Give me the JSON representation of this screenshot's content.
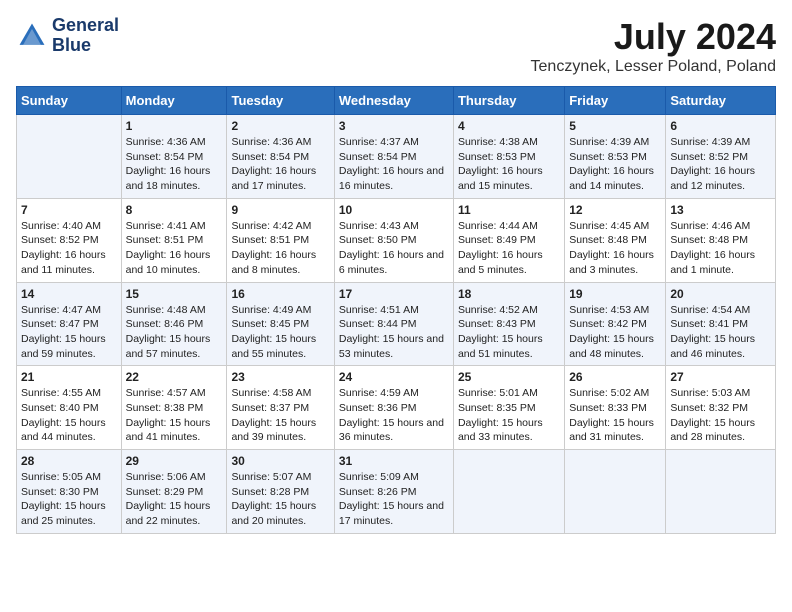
{
  "logo": {
    "line1": "General",
    "line2": "Blue"
  },
  "title": "July 2024",
  "subtitle": "Tenczynek, Lesser Poland, Poland",
  "days_header": [
    "Sunday",
    "Monday",
    "Tuesday",
    "Wednesday",
    "Thursday",
    "Friday",
    "Saturday"
  ],
  "weeks": [
    [
      {
        "day": "",
        "sunrise": "",
        "sunset": "",
        "daylight": ""
      },
      {
        "day": "1",
        "sunrise": "Sunrise: 4:36 AM",
        "sunset": "Sunset: 8:54 PM",
        "daylight": "Daylight: 16 hours and 18 minutes."
      },
      {
        "day": "2",
        "sunrise": "Sunrise: 4:36 AM",
        "sunset": "Sunset: 8:54 PM",
        "daylight": "Daylight: 16 hours and 17 minutes."
      },
      {
        "day": "3",
        "sunrise": "Sunrise: 4:37 AM",
        "sunset": "Sunset: 8:54 PM",
        "daylight": "Daylight: 16 hours and 16 minutes."
      },
      {
        "day": "4",
        "sunrise": "Sunrise: 4:38 AM",
        "sunset": "Sunset: 8:53 PM",
        "daylight": "Daylight: 16 hours and 15 minutes."
      },
      {
        "day": "5",
        "sunrise": "Sunrise: 4:39 AM",
        "sunset": "Sunset: 8:53 PM",
        "daylight": "Daylight: 16 hours and 14 minutes."
      },
      {
        "day": "6",
        "sunrise": "Sunrise: 4:39 AM",
        "sunset": "Sunset: 8:52 PM",
        "daylight": "Daylight: 16 hours and 12 minutes."
      }
    ],
    [
      {
        "day": "7",
        "sunrise": "Sunrise: 4:40 AM",
        "sunset": "Sunset: 8:52 PM",
        "daylight": "Daylight: 16 hours and 11 minutes."
      },
      {
        "day": "8",
        "sunrise": "Sunrise: 4:41 AM",
        "sunset": "Sunset: 8:51 PM",
        "daylight": "Daylight: 16 hours and 10 minutes."
      },
      {
        "day": "9",
        "sunrise": "Sunrise: 4:42 AM",
        "sunset": "Sunset: 8:51 PM",
        "daylight": "Daylight: 16 hours and 8 minutes."
      },
      {
        "day": "10",
        "sunrise": "Sunrise: 4:43 AM",
        "sunset": "Sunset: 8:50 PM",
        "daylight": "Daylight: 16 hours and 6 minutes."
      },
      {
        "day": "11",
        "sunrise": "Sunrise: 4:44 AM",
        "sunset": "Sunset: 8:49 PM",
        "daylight": "Daylight: 16 hours and 5 minutes."
      },
      {
        "day": "12",
        "sunrise": "Sunrise: 4:45 AM",
        "sunset": "Sunset: 8:48 PM",
        "daylight": "Daylight: 16 hours and 3 minutes."
      },
      {
        "day": "13",
        "sunrise": "Sunrise: 4:46 AM",
        "sunset": "Sunset: 8:48 PM",
        "daylight": "Daylight: 16 hours and 1 minute."
      }
    ],
    [
      {
        "day": "14",
        "sunrise": "Sunrise: 4:47 AM",
        "sunset": "Sunset: 8:47 PM",
        "daylight": "Daylight: 15 hours and 59 minutes."
      },
      {
        "day": "15",
        "sunrise": "Sunrise: 4:48 AM",
        "sunset": "Sunset: 8:46 PM",
        "daylight": "Daylight: 15 hours and 57 minutes."
      },
      {
        "day": "16",
        "sunrise": "Sunrise: 4:49 AM",
        "sunset": "Sunset: 8:45 PM",
        "daylight": "Daylight: 15 hours and 55 minutes."
      },
      {
        "day": "17",
        "sunrise": "Sunrise: 4:51 AM",
        "sunset": "Sunset: 8:44 PM",
        "daylight": "Daylight: 15 hours and 53 minutes."
      },
      {
        "day": "18",
        "sunrise": "Sunrise: 4:52 AM",
        "sunset": "Sunset: 8:43 PM",
        "daylight": "Daylight: 15 hours and 51 minutes."
      },
      {
        "day": "19",
        "sunrise": "Sunrise: 4:53 AM",
        "sunset": "Sunset: 8:42 PM",
        "daylight": "Daylight: 15 hours and 48 minutes."
      },
      {
        "day": "20",
        "sunrise": "Sunrise: 4:54 AM",
        "sunset": "Sunset: 8:41 PM",
        "daylight": "Daylight: 15 hours and 46 minutes."
      }
    ],
    [
      {
        "day": "21",
        "sunrise": "Sunrise: 4:55 AM",
        "sunset": "Sunset: 8:40 PM",
        "daylight": "Daylight: 15 hours and 44 minutes."
      },
      {
        "day": "22",
        "sunrise": "Sunrise: 4:57 AM",
        "sunset": "Sunset: 8:38 PM",
        "daylight": "Daylight: 15 hours and 41 minutes."
      },
      {
        "day": "23",
        "sunrise": "Sunrise: 4:58 AM",
        "sunset": "Sunset: 8:37 PM",
        "daylight": "Daylight: 15 hours and 39 minutes."
      },
      {
        "day": "24",
        "sunrise": "Sunrise: 4:59 AM",
        "sunset": "Sunset: 8:36 PM",
        "daylight": "Daylight: 15 hours and 36 minutes."
      },
      {
        "day": "25",
        "sunrise": "Sunrise: 5:01 AM",
        "sunset": "Sunset: 8:35 PM",
        "daylight": "Daylight: 15 hours and 33 minutes."
      },
      {
        "day": "26",
        "sunrise": "Sunrise: 5:02 AM",
        "sunset": "Sunset: 8:33 PM",
        "daylight": "Daylight: 15 hours and 31 minutes."
      },
      {
        "day": "27",
        "sunrise": "Sunrise: 5:03 AM",
        "sunset": "Sunset: 8:32 PM",
        "daylight": "Daylight: 15 hours and 28 minutes."
      }
    ],
    [
      {
        "day": "28",
        "sunrise": "Sunrise: 5:05 AM",
        "sunset": "Sunset: 8:30 PM",
        "daylight": "Daylight: 15 hours and 25 minutes."
      },
      {
        "day": "29",
        "sunrise": "Sunrise: 5:06 AM",
        "sunset": "Sunset: 8:29 PM",
        "daylight": "Daylight: 15 hours and 22 minutes."
      },
      {
        "day": "30",
        "sunrise": "Sunrise: 5:07 AM",
        "sunset": "Sunset: 8:28 PM",
        "daylight": "Daylight: 15 hours and 20 minutes."
      },
      {
        "day": "31",
        "sunrise": "Sunrise: 5:09 AM",
        "sunset": "Sunset: 8:26 PM",
        "daylight": "Daylight: 15 hours and 17 minutes."
      },
      {
        "day": "",
        "sunrise": "",
        "sunset": "",
        "daylight": ""
      },
      {
        "day": "",
        "sunrise": "",
        "sunset": "",
        "daylight": ""
      },
      {
        "day": "",
        "sunrise": "",
        "sunset": "",
        "daylight": ""
      }
    ]
  ]
}
